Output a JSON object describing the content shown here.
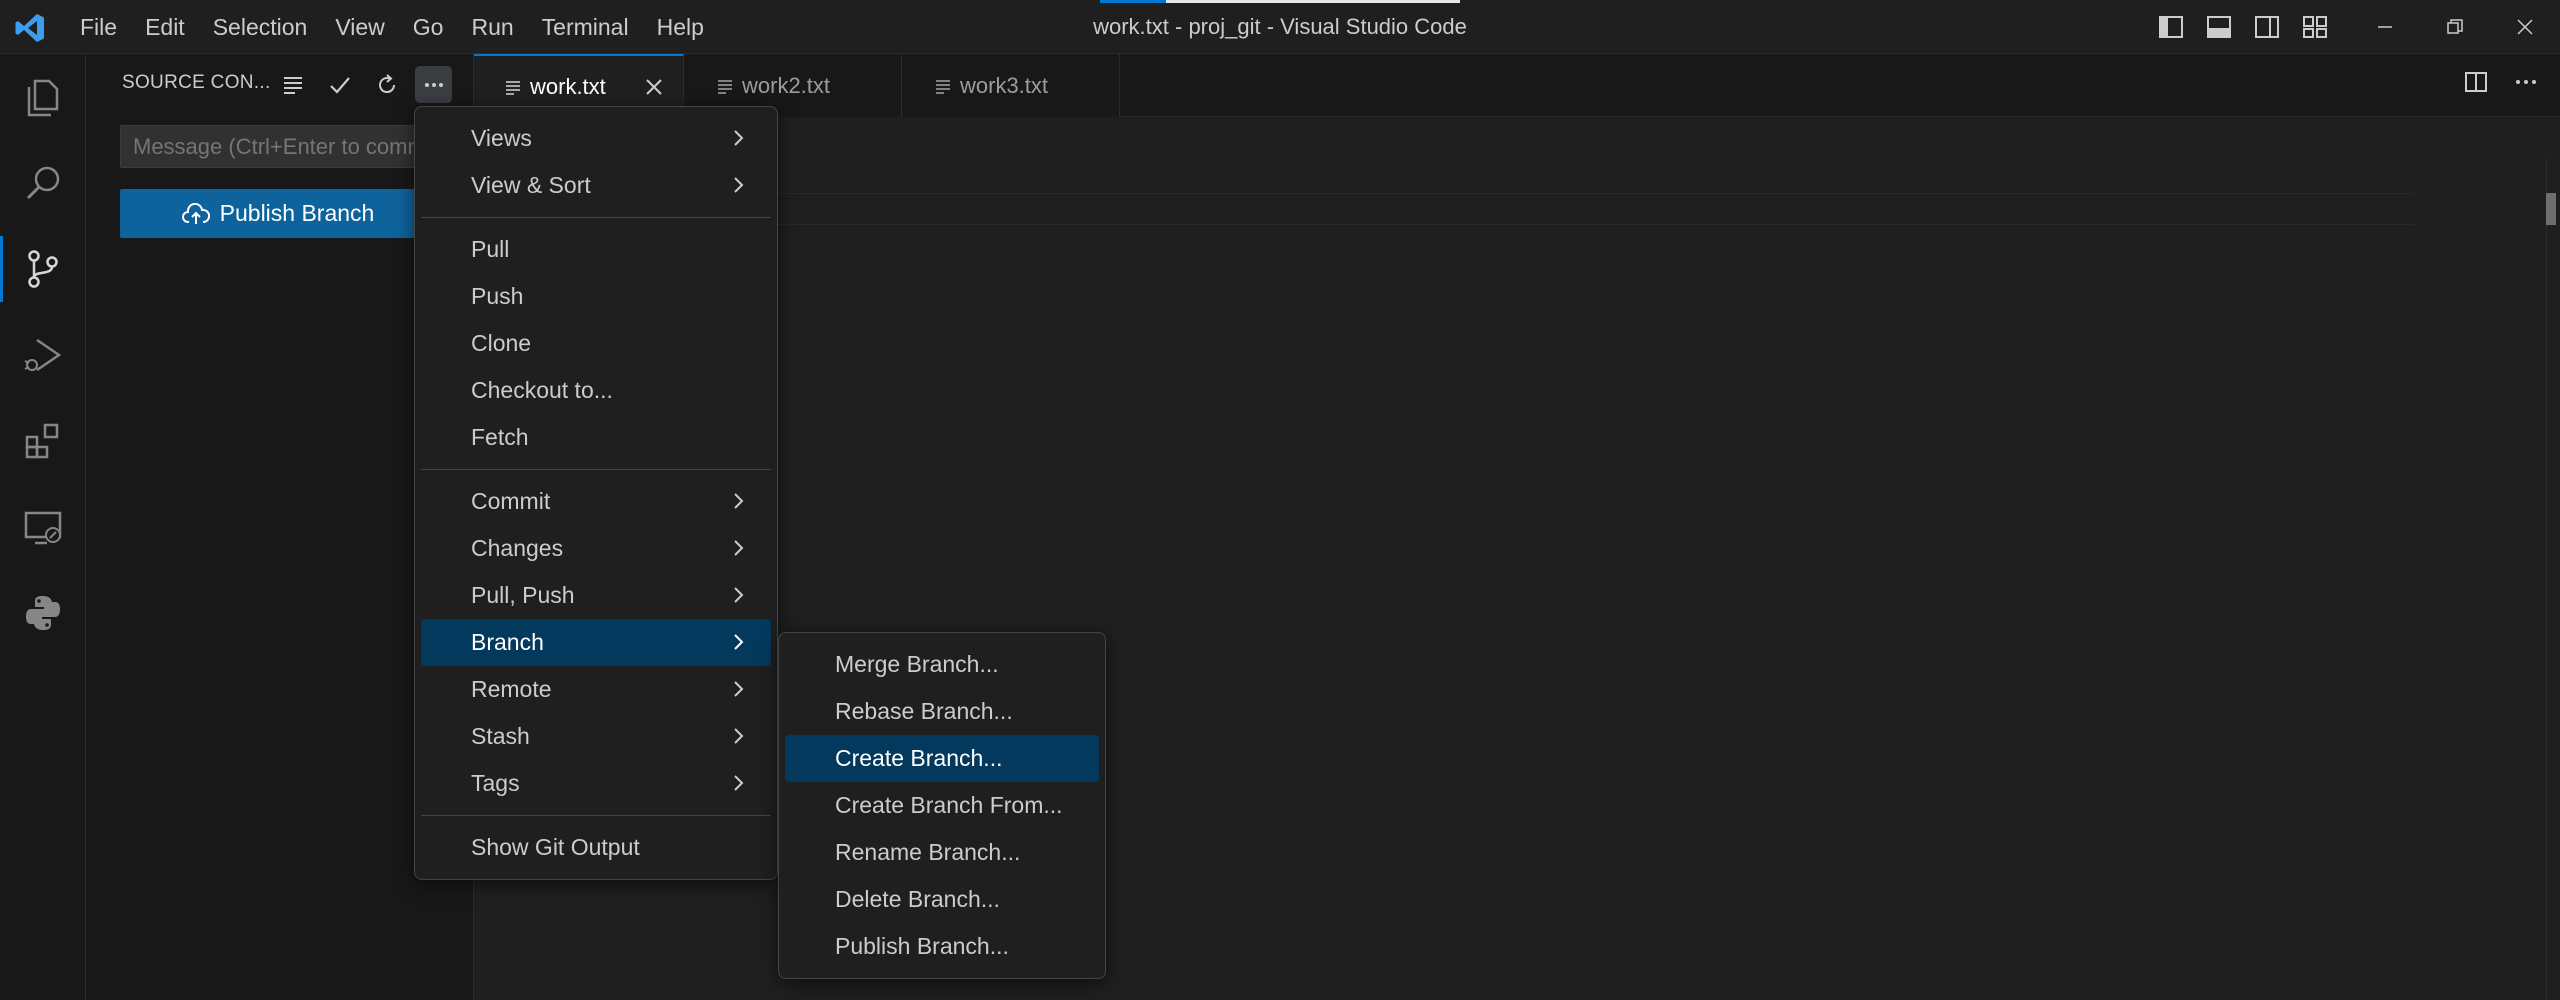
{
  "window": {
    "title": "work.txt - proj_git - Visual Studio Code",
    "menus": [
      "File",
      "Edit",
      "Selection",
      "View",
      "Go",
      "Run",
      "Terminal",
      "Help"
    ]
  },
  "activity_bar": {
    "items": [
      "explorer-icon",
      "search-icon",
      "source-control-icon",
      "run-debug-icon",
      "extensions-icon",
      "remote-explorer-icon",
      "python-icon"
    ],
    "active": "source-control-icon"
  },
  "sidebar": {
    "title": "SOURCE CON...",
    "message_placeholder": "Message (Ctrl+Enter to commit on 'main')",
    "publish_label": "Publish Branch"
  },
  "tabs": [
    {
      "label": "work.txt",
      "active": true
    },
    {
      "label": "work2.txt",
      "active": false
    },
    {
      "label": "work3.txt",
      "active": false
    }
  ],
  "context_menu": {
    "groups": [
      [
        {
          "label": "Views",
          "submenu": true
        },
        {
          "label": "View & Sort",
          "submenu": true
        }
      ],
      [
        {
          "label": "Pull"
        },
        {
          "label": "Push"
        },
        {
          "label": "Clone"
        },
        {
          "label": "Checkout to..."
        },
        {
          "label": "Fetch"
        }
      ],
      [
        {
          "label": "Commit",
          "submenu": true
        },
        {
          "label": "Changes",
          "submenu": true
        },
        {
          "label": "Pull, Push",
          "submenu": true
        },
        {
          "label": "Branch",
          "submenu": true,
          "highlighted": true
        },
        {
          "label": "Remote",
          "submenu": true
        },
        {
          "label": "Stash",
          "submenu": true
        },
        {
          "label": "Tags",
          "submenu": true
        }
      ],
      [
        {
          "label": "Show Git Output"
        }
      ]
    ]
  },
  "branch_submenu": {
    "items": [
      {
        "label": "Merge Branch..."
      },
      {
        "label": "Rebase Branch..."
      },
      {
        "label": "Create Branch...",
        "highlighted": true
      },
      {
        "label": "Create Branch From..."
      },
      {
        "label": "Rename Branch..."
      },
      {
        "label": "Delete Branch..."
      },
      {
        "label": "Publish Branch..."
      }
    ]
  },
  "colors": {
    "accent": "#0078d4",
    "button_bg": "#0e639c",
    "menu_highlight": "#04395e",
    "logo": "#3b9cf0"
  }
}
